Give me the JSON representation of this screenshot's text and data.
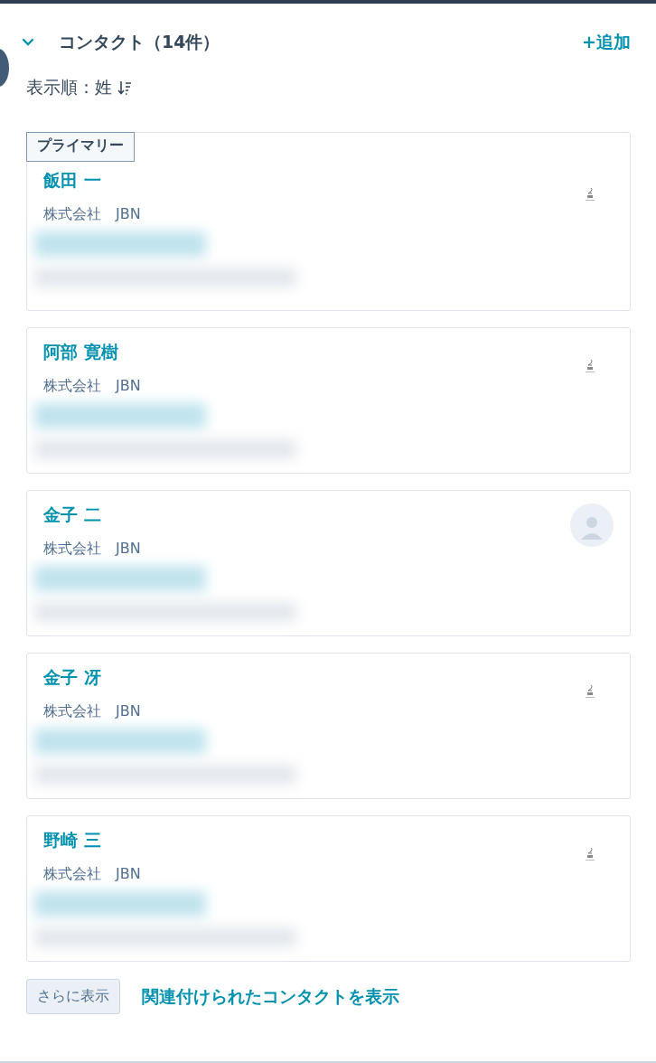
{
  "section": {
    "title": "コンタクト（14件）",
    "expanded": true,
    "add_label": "+追加"
  },
  "sort": {
    "label": "表示順：姓"
  },
  "contacts": [
    {
      "name": "飯田 一",
      "company": "株式会社　JBN",
      "primary": true,
      "badge": "プライマリー",
      "kind": "broken-image",
      "details_redacted": true
    },
    {
      "name": "阿部 寛樹",
      "company": "株式会社　JBN",
      "primary": false,
      "kind": "broken-image",
      "details_redacted": true
    },
    {
      "name": "金子 二",
      "company": "株式会社　JBN",
      "primary": false,
      "kind": "placeholder",
      "details_redacted": true
    },
    {
      "name": "金子 冴",
      "company": "株式会社　JBN",
      "primary": false,
      "kind": "broken-image",
      "details_redacted": true
    },
    {
      "name": "野崎 三",
      "company": "株式会社　JBN",
      "primary": false,
      "kind": "broken-image",
      "details_redacted": true
    }
  ],
  "footer": {
    "more_button": "さらに表示",
    "view_link": "関連付けられたコンタクトを表示"
  }
}
